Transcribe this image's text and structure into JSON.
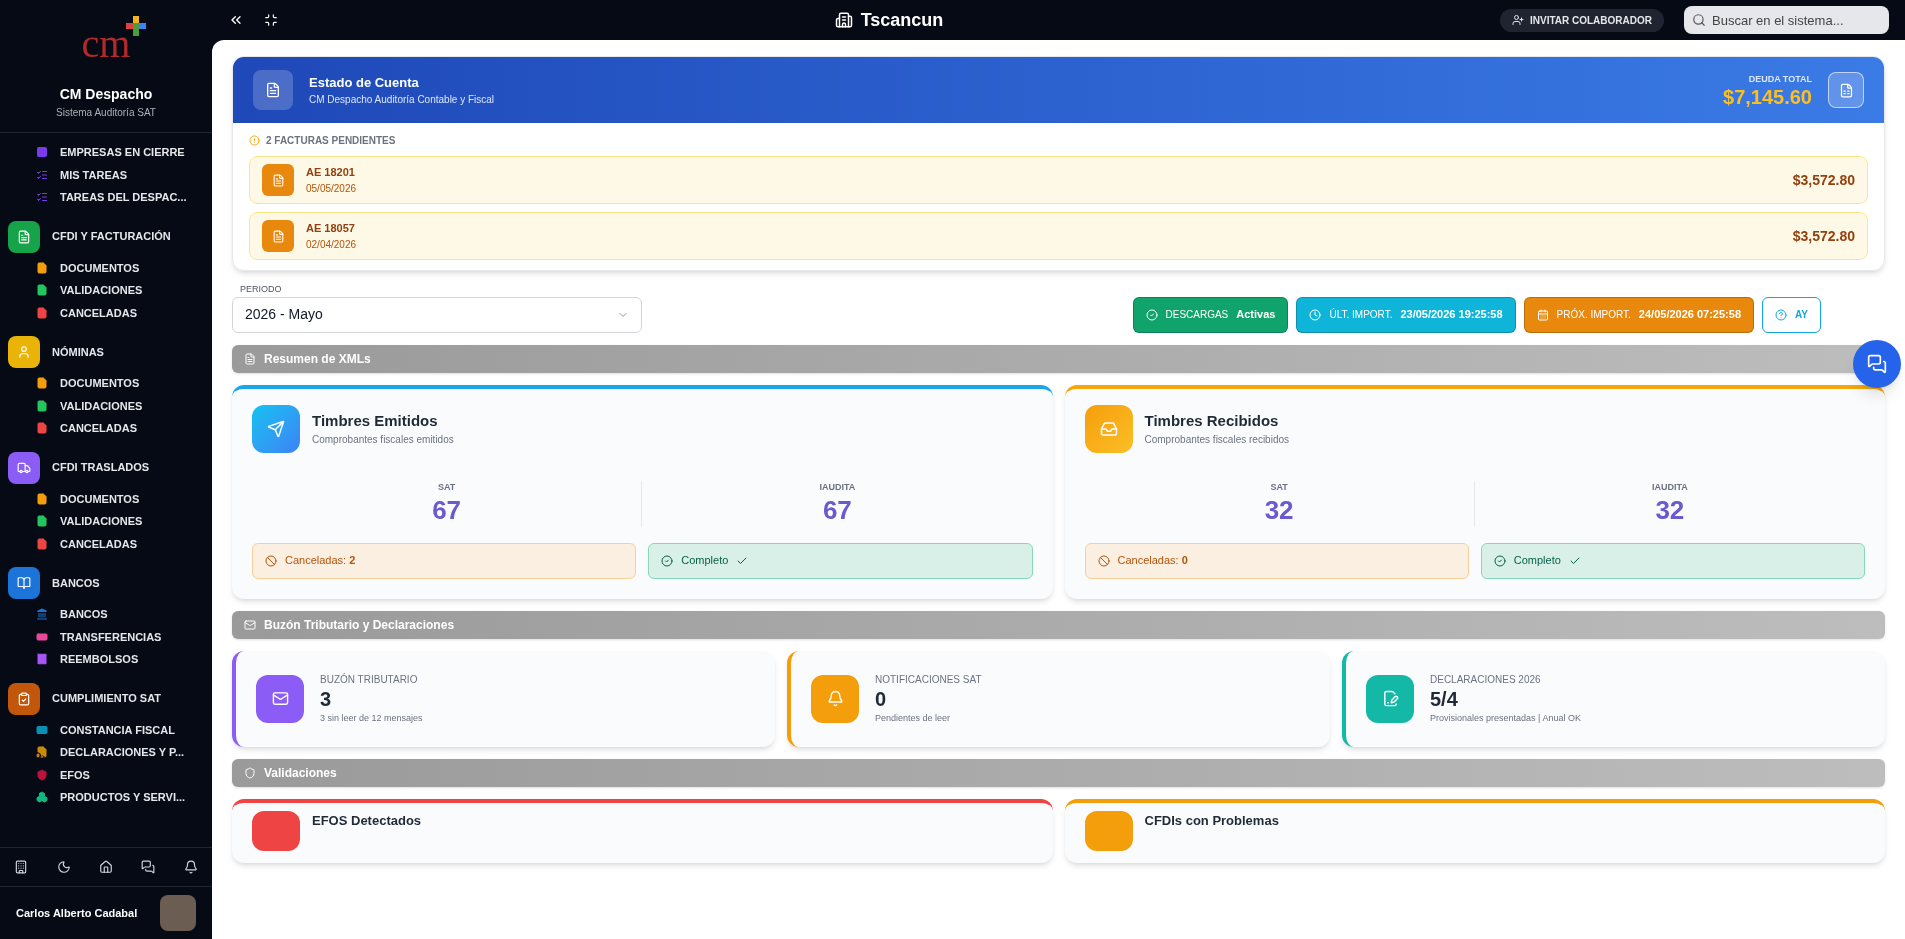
{
  "sidebar": {
    "logo_text": "cm",
    "brand": "CM Despacho",
    "subtitle": "Sistema Auditoría SAT",
    "sections": [
      {
        "kind": "none",
        "items": [
          {
            "label": "EMPRESAS EN CIERRE",
            "kind": "grid",
            "color": "#7c3aed"
          },
          {
            "label": "MIS TAREAS",
            "kind": "tasks",
            "color": "#7c3aed"
          },
          {
            "label": "TAREAS DEL DESPAC...",
            "kind": "tasks",
            "color": "#7c3aed"
          }
        ]
      },
      {
        "title": "CFDI Y FACTURACIÓN",
        "kind": "doc",
        "color": "#16a34a",
        "items": [
          {
            "label": "DOCUMENTOS",
            "kind": "xml",
            "color": "#f59e0b"
          },
          {
            "label": "VALIDACIONES",
            "kind": "validate",
            "color": "#22c55e"
          },
          {
            "label": "CANCELADAS",
            "kind": "cancel",
            "color": "#ef4444"
          }
        ]
      },
      {
        "title": "NÓMINAS",
        "kind": "badge",
        "color": "#eab308",
        "items": [
          {
            "label": "DOCUMENTOS",
            "kind": "xml",
            "color": "#f59e0b"
          },
          {
            "label": "VALIDACIONES",
            "kind": "validate",
            "color": "#22c55e"
          },
          {
            "label": "CANCELADAS",
            "kind": "cancel",
            "color": "#ef4444"
          }
        ]
      },
      {
        "title": "CFDI TRASLADOS",
        "kind": "truck",
        "color": "#8b5cf6",
        "items": [
          {
            "label": "DOCUMENTOS",
            "kind": "xml",
            "color": "#f59e0b"
          },
          {
            "label": "VALIDACIONES",
            "kind": "validate",
            "color": "#22c55e"
          },
          {
            "label": "CANCELADAS",
            "kind": "cancel",
            "color": "#ef4444"
          }
        ]
      },
      {
        "title": "BANCOS",
        "kind": "book",
        "color": "#1d74d8",
        "items": [
          {
            "label": "BANCOS",
            "kind": "bank",
            "color": "#1d74d8"
          },
          {
            "label": "TRANSFERENCIAS",
            "kind": "money",
            "color": "#ec4899"
          },
          {
            "label": "REEMBOLSOS",
            "kind": "receipt",
            "color": "#a855f7"
          }
        ]
      },
      {
        "title": "CUMPLIMIENTO SAT",
        "kind": "clipboard",
        "color": "#c2570c",
        "items": [
          {
            "label": "CONSTANCIA FISCAL",
            "kind": "id",
            "color": "#0891b2"
          },
          {
            "label": "DECLARACIONES Y P...",
            "kind": "dollarfile",
            "color": "#ca8a04"
          },
          {
            "label": "EFOS",
            "kind": "shield",
            "color": "#be123c"
          },
          {
            "label": "PRODUCTOS Y SERVI...",
            "kind": "boxes",
            "color": "#10b981"
          }
        ]
      }
    ],
    "user": "Carlos Alberto Cadabal"
  },
  "topbar": {
    "title": "Tscancun",
    "invite": "INVITAR COLABORADOR",
    "search_placeholder": "Buscar en el sistema..."
  },
  "account": {
    "title": "Estado de Cuenta",
    "subtitle": "CM Despacho Auditoría Contable y Fiscal",
    "debt_label": "DEUDA TOTAL",
    "debt": "$7,145.60",
    "pending": "2 FACTURAS PENDIENTES",
    "invoices": [
      {
        "number": "AE 18201",
        "date": "05/05/2026",
        "amount": "$3,572.80"
      },
      {
        "number": "AE 18057",
        "date": "02/04/2026",
        "amount": "$3,572.80"
      }
    ]
  },
  "period": {
    "label": "PERIODO",
    "value": "2026 - Mayo"
  },
  "chips": [
    {
      "kind": "ok",
      "label": "DESCARGAS",
      "value": "Activas",
      "color": "#10a36b"
    },
    {
      "kind": "clock",
      "label": "ÚLT. IMPORT.",
      "value": "23/05/2026 19:25:58",
      "color": "#0fb5d8"
    },
    {
      "kind": "calendar",
      "label": "PRÓX. IMPORT.",
      "value": "24/05/2026 07:25:58",
      "color": "#e8880c"
    },
    {
      "kind": "help",
      "label": "AY",
      "color": "#ffffff"
    }
  ],
  "xml_section": "Resumen de XMLs",
  "stamp_cards": [
    {
      "kind": "send",
      "title": "Timbres Emitidos",
      "subtitle": "Comprobantes fiscales emitidos",
      "stats": [
        {
          "label": "SAT",
          "value": "67"
        },
        {
          "label": "IAUDITA",
          "value": "67"
        }
      ],
      "cancel_label": "Canceladas:",
      "cancel_value": "2",
      "status": "Completo"
    },
    {
      "kind": "inbox",
      "title": "Timbres Recibidos",
      "subtitle": "Comprobantes fiscales recibidos",
      "stats": [
        {
          "label": "SAT",
          "value": "32"
        },
        {
          "label": "IAUDITA",
          "value": "32"
        }
      ],
      "cancel_label": "Canceladas:",
      "cancel_value": "0",
      "status": "Completo"
    }
  ],
  "mail_section": "Buzón Tributario y Declaraciones",
  "mail_cards": [
    {
      "kind": "mail",
      "color": "#8b5cf6",
      "label": "BUZÓN TRIBUTARIO",
      "value": "3",
      "note": "3 sin leer de 12 mensajes"
    },
    {
      "kind": "bell",
      "color": "#f59e0b",
      "label": "NOTIFICACIONES SAT",
      "value": "0",
      "note": "Pendientes de leer"
    },
    {
      "kind": "file",
      "color": "#14b8a6",
      "label": "DECLARACIONES 2026",
      "value": "5/4",
      "note": "Provisionales presentadas | Anual OK"
    }
  ],
  "validation_section": "Validaciones",
  "validation_cards": [
    {
      "title": "EFOS Detectados",
      "color": "#ef4444"
    },
    {
      "title": "CFDIs con Problemas",
      "color": "#f59e0b"
    }
  ]
}
